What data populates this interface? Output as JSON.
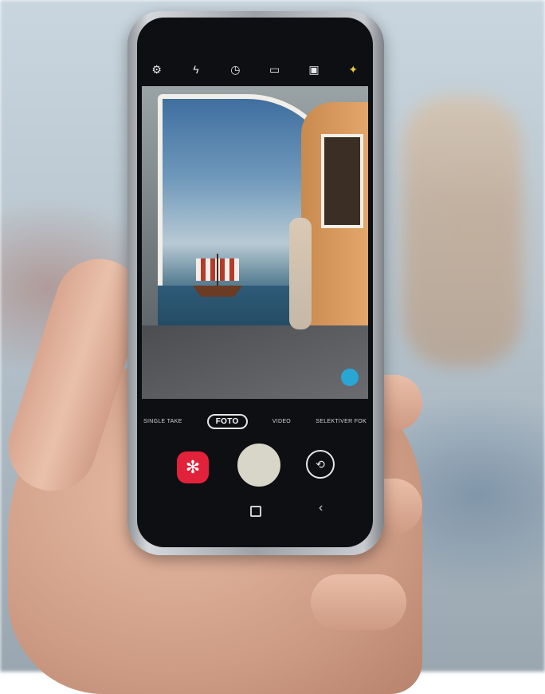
{
  "camera": {
    "toolbar_icons": [
      "settings-icon",
      "flash-off-icon",
      "timer-icon",
      "aspect-ratio-icon",
      "sticker-icon",
      "filter-icon"
    ],
    "modes": [
      "SINGLE TAKE",
      "FOTO",
      "VIDEO",
      "SELEKTIVER FOK"
    ],
    "active_mode": "FOTO",
    "bixby_icon": "bixby-vision-icon",
    "switch_camera_icon": "switch-camera-icon",
    "nav": {
      "home_icon": "home-icon",
      "back_icon": "back-icon"
    },
    "colors": {
      "bixby": "#e2223a",
      "shutter": "#d8d6c9",
      "focus_dot": "#2aa6d5"
    }
  }
}
